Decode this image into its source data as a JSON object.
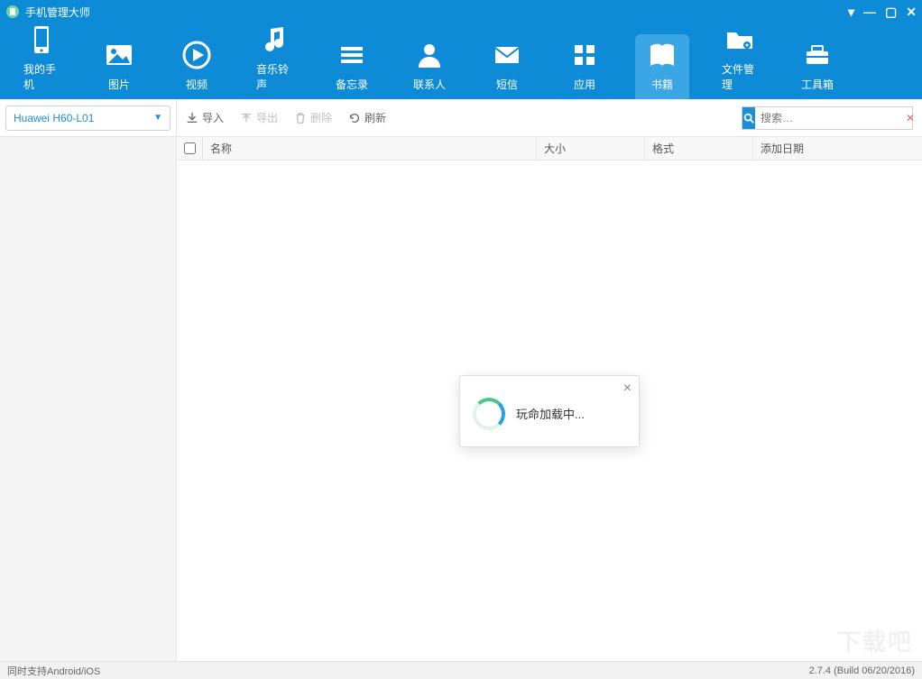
{
  "app": {
    "title": "手机管理大师"
  },
  "window_controls": {
    "menu": "▾",
    "minimize": "—",
    "maximize": "▢",
    "close": "✕"
  },
  "nav": {
    "items": [
      {
        "key": "my-phone",
        "label": "我的手机",
        "icon": "phone"
      },
      {
        "key": "photos",
        "label": "图片",
        "icon": "image"
      },
      {
        "key": "videos",
        "label": "视频",
        "icon": "play"
      },
      {
        "key": "music",
        "label": "音乐铃声",
        "icon": "music"
      },
      {
        "key": "notes",
        "label": "备忘录",
        "icon": "list"
      },
      {
        "key": "contacts",
        "label": "联系人",
        "icon": "person"
      },
      {
        "key": "sms",
        "label": "短信",
        "icon": "mail"
      },
      {
        "key": "apps",
        "label": "应用",
        "icon": "grid"
      },
      {
        "key": "books",
        "label": "书籍",
        "icon": "book",
        "active": true
      },
      {
        "key": "files",
        "label": "文件管理",
        "icon": "folder-gear"
      },
      {
        "key": "tools",
        "label": "工具箱",
        "icon": "toolbox"
      }
    ]
  },
  "device": {
    "selected": "Huawei H60-L01"
  },
  "toolbar": {
    "import_label": "导入",
    "export_label": "导出",
    "delete_label": "删除",
    "refresh_label": "刷新"
  },
  "search": {
    "placeholder": "搜索…",
    "value": ""
  },
  "table": {
    "columns": {
      "name": "名称",
      "size": "大小",
      "format": "格式",
      "date_added": "添加日期"
    },
    "rows": []
  },
  "dialog": {
    "loading_text": "玩命加载中..."
  },
  "status": {
    "left": "同时支持Android/iOS",
    "right": "2.7.4 (Build 06/20/2016)"
  },
  "watermark": "下载吧"
}
